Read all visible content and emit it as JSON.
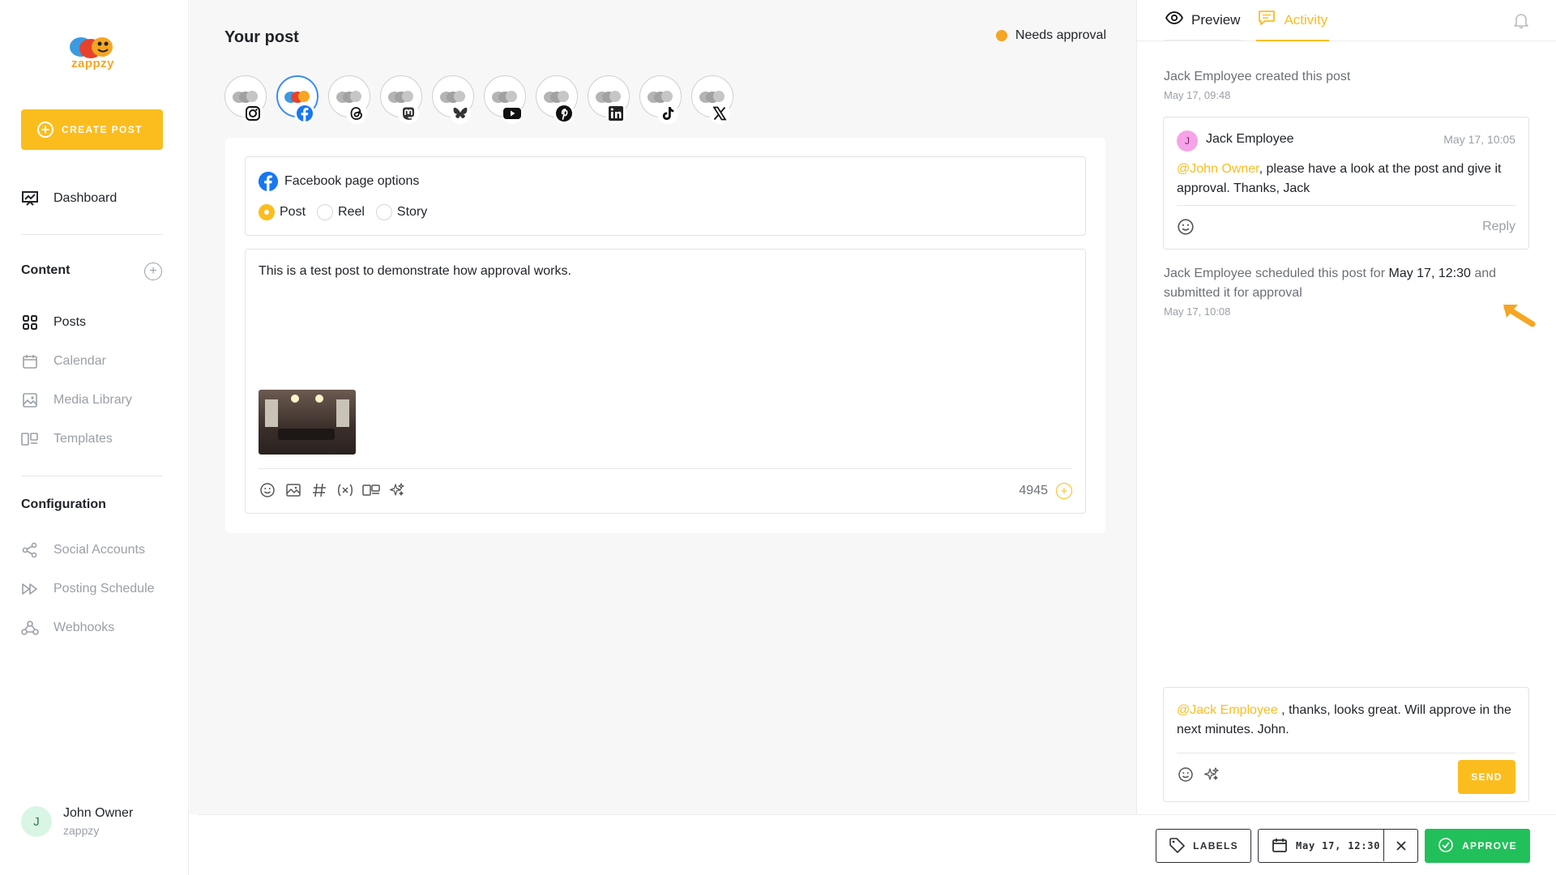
{
  "sidebar": {
    "logo_text": "zappzy",
    "create_label": "CREATE POST",
    "dashboard_label": "Dashboard",
    "content_title": "Content",
    "content_items": [
      "Posts",
      "Calendar",
      "Media Library",
      "Templates"
    ],
    "configuration_title": "Configuration",
    "config_items": [
      "Social Accounts",
      "Posting Schedule",
      "Webhooks"
    ],
    "user": {
      "initial": "J",
      "name": "John Owner",
      "org": "zappzy"
    }
  },
  "main": {
    "title": "Your post",
    "status": "Needs approval",
    "status_color": "#f6a623",
    "channels": [
      "instagram",
      "facebook",
      "threads",
      "mastodon",
      "bluesky",
      "youtube",
      "pinterest",
      "linkedin",
      "tiktok",
      "x"
    ],
    "selected_channel": "facebook",
    "fb_options_title": "Facebook page options",
    "post_types": [
      "Post",
      "Reel",
      "Story"
    ],
    "selected_post_type": "Post",
    "editor_text": "This is a test post to demonstrate how approval works.",
    "char_count": "4945"
  },
  "panel": {
    "tab_preview": "Preview",
    "tab_activity": "Activity",
    "activity1_text": "Jack Employee created this post",
    "activity1_time": "May 17, 09:48",
    "comment": {
      "initial": "J",
      "author": "Jack Employee",
      "time": "May 17, 10:05",
      "mention": "@John Owner",
      "text": ", please have a look at the post and give it approval. Thanks, Jack",
      "reply_label": "Reply"
    },
    "activity2_prefix": "Jack Employee scheduled this post for",
    "activity2_date": "May 17, 12:30",
    "activity2_mid": "and",
    "activity2_suffix": "submitted it for approval",
    "activity2_time": "May 17, 10:08",
    "reply_mention": "@Jack Employee",
    "reply_text": " , thanks, looks great. Will approve in the next minutes. John.",
    "send_label": "SEND"
  },
  "bottom": {
    "labels_label": "LABELS",
    "date_label": "May 17, 12:30",
    "approve_label": "APPROVE"
  },
  "colors": {
    "accent": "#fbbd1e",
    "approve": "#22c05a",
    "facebook": "#1877f2"
  }
}
